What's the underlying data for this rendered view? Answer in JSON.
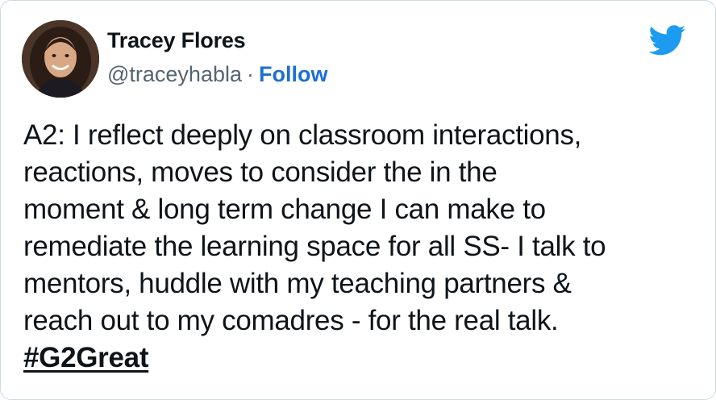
{
  "author": {
    "display_name": "Tracey Flores",
    "handle": "@traceyhabla",
    "separator": "·",
    "follow_label": "Follow",
    "avatar_icon": "profile-photo"
  },
  "platform_icon": "twitter-bird-icon",
  "colors": {
    "follow_link": "#1d6fd1",
    "bird": "#1d9bf0",
    "handle_gray": "#536471"
  },
  "tweet": {
    "lines": [
      "A2: I reflect deeply on classroom interactions,",
      "reactions, moves to consider the in the",
      "moment & long term change I can make to",
      "remediate the learning space for all SS- I talk to",
      "mentors, huddle with my teaching partners &",
      "reach out to my comadres - for the real talk."
    ],
    "hashtag": "#G2Great"
  }
}
